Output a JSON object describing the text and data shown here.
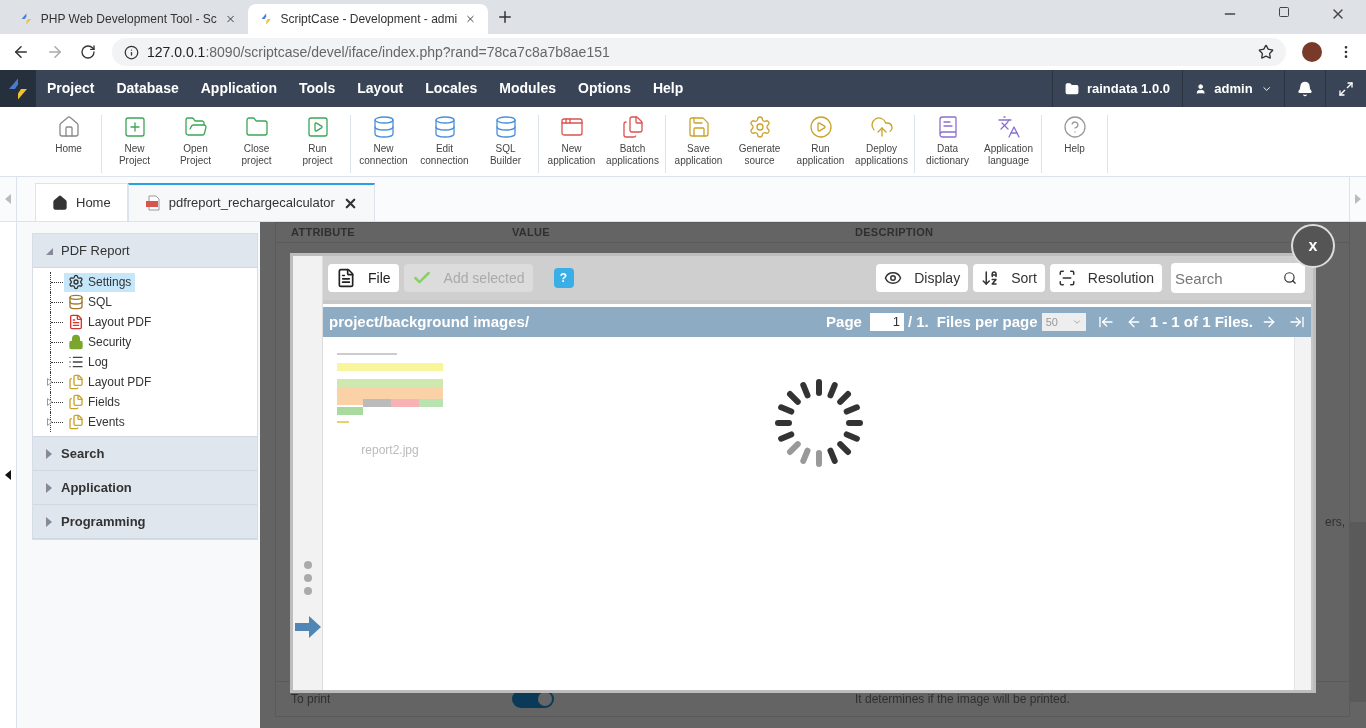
{
  "browser": {
    "tabs": [
      {
        "title": "PHP Web Development Tool - Sc",
        "selected": false
      },
      {
        "title": "ScriptCase - Development - admi",
        "selected": true
      }
    ],
    "url": {
      "host": "127.0.0.1",
      "rest": ":8090/scriptcase/devel/iface/index.php?rand=78ca7c8a7b8ae151"
    }
  },
  "menu": [
    "Project",
    "Database",
    "Application",
    "Tools",
    "Layout",
    "Locales",
    "Modules",
    "Options",
    "Help"
  ],
  "project": "raindata 1.0.0",
  "user": "admin",
  "toolbar": [
    [
      "Home"
    ],
    [
      "New\nProject",
      "Open\nProject",
      "Close\nproject",
      "Run\nproject"
    ],
    [
      "New\nconnection",
      "Edit\nconnection",
      "SQL\nBuilder"
    ],
    [
      "New\napplication",
      "Batch\napplications"
    ],
    [
      "Save\napplication",
      "Generate\nsource",
      "Run\napplication",
      "Deploy\napplications"
    ],
    [
      "Data\ndictionary",
      "Application\nlanguage"
    ],
    [
      "Help"
    ]
  ],
  "app_tabs": [
    {
      "label": "Home",
      "kind": "home",
      "selected": false
    },
    {
      "label": "pdfreport_rechargecalculator",
      "kind": "pdf",
      "selected": true
    }
  ],
  "sidebar": [
    {
      "title": "PDF Report",
      "expanded": true,
      "children": [
        {
          "label": "Settings",
          "selected": true,
          "expandable": false
        },
        {
          "label": "SQL",
          "selected": false,
          "expandable": false
        },
        {
          "label": "Layout PDF",
          "selected": false,
          "expandable": false
        },
        {
          "label": "Security",
          "selected": false,
          "expandable": false
        },
        {
          "label": "Log",
          "selected": false,
          "expandable": false
        },
        {
          "label": "Layout PDF",
          "selected": false,
          "expandable": true
        },
        {
          "label": "Fields",
          "selected": false,
          "expandable": true
        },
        {
          "label": "Events",
          "selected": false,
          "expandable": true
        }
      ]
    },
    {
      "title": "Search",
      "expanded": false
    },
    {
      "title": "Application",
      "expanded": false
    },
    {
      "title": "Programming",
      "expanded": false
    }
  ],
  "settings_table": {
    "columns": [
      "ATTRIBUTE",
      "VALUE",
      "DESCRIPTION"
    ],
    "partial_text": "ers,",
    "row": {
      "attribute": "To print",
      "on": true,
      "description": "It determines if the image will be printed."
    }
  },
  "file_manager": {
    "close": "x",
    "buttons": [
      {
        "label": "File",
        "kind": "file",
        "disabled": false
      },
      {
        "label": "Add selected",
        "kind": "check",
        "disabled": true
      },
      {
        "label": "?",
        "kind": "help",
        "disabled": false
      }
    ],
    "view_buttons": [
      {
        "label": "Display",
        "kind": "eye"
      },
      {
        "label": "Sort",
        "kind": "sort"
      },
      {
        "label": "Resolution",
        "kind": "resize"
      }
    ],
    "search": {
      "placeholder": "Search"
    },
    "path": "project/background images/",
    "page_label": "Page",
    "page": "1",
    "page_total": "/ 1.",
    "per_page_label": "Files per page",
    "per_page": "50",
    "range": "1 - 1 of 1 Files.",
    "files": [
      {
        "name": "report2.jpg"
      }
    ]
  }
}
